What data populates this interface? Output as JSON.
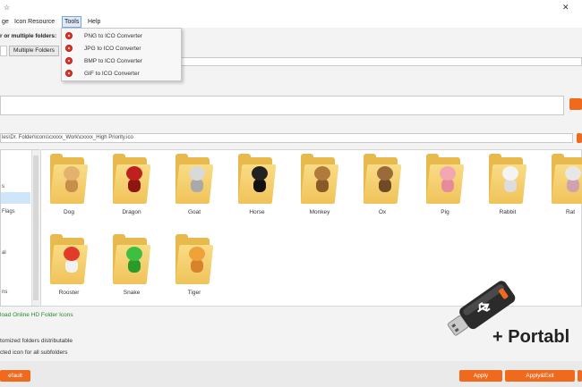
{
  "window": {
    "close_glyph": "✕"
  },
  "menubar": {
    "items": [
      {
        "label": "ge"
      },
      {
        "label": "Icon Resource"
      },
      {
        "label": "Tools"
      },
      {
        "label": "Help"
      }
    ]
  },
  "tools_menu": {
    "items": [
      {
        "label": "PNG to ICO Converter",
        "icon": "converter-icon"
      },
      {
        "label": "JPG to ICO Converter",
        "icon": "converter-icon"
      },
      {
        "label": "BMP to ICO Converter",
        "icon": "converter-icon"
      },
      {
        "label": "GIF to ICO Converter",
        "icon": "converter-icon"
      }
    ]
  },
  "selection": {
    "prompt": "r or multiple folders:",
    "multiple_folders_button": "Multiple Folders"
  },
  "icon_path": "les\\Dr. Folder\\icons\\cxxxx_Work\\cxxxx_High Priority.ico",
  "tree": {
    "items": [
      {
        "label": "s"
      },
      {
        "label": "Flags"
      },
      {
        "label": "al"
      },
      {
        "label": "ns"
      }
    ]
  },
  "icons": [
    {
      "name": "Dog",
      "head": "#e3b36e",
      "body": "#c98f4a"
    },
    {
      "name": "Dragon",
      "head": "#c0201d",
      "body": "#8f1512"
    },
    {
      "name": "Goat",
      "head": "#d9d9d9",
      "body": "#a9a9a9"
    },
    {
      "name": "Horse",
      "head": "#222222",
      "body": "#111111"
    },
    {
      "name": "Monkey",
      "head": "#b07a3c",
      "body": "#8a5a28"
    },
    {
      "name": "Ox",
      "head": "#9a6a3a",
      "body": "#6f4a24"
    },
    {
      "name": "Pig",
      "head": "#f2a7b3",
      "body": "#e58b9c"
    },
    {
      "name": "Rabbit",
      "head": "#f4f4f4",
      "body": "#dddddd"
    },
    {
      "name": "Rat",
      "head": "#e7e7e7",
      "body": "#d0a2b0"
    },
    {
      "name": "Rooster",
      "head": "#e23b2a",
      "body": "#f2f2f2"
    },
    {
      "name": "Snake",
      "head": "#3fbf3f",
      "body": "#2a9a2a"
    },
    {
      "name": "Tiger",
      "head": "#f0a23a",
      "body": "#d8822a"
    }
  ],
  "download_link": "load Online HD Folder Icons",
  "options": [
    {
      "label": "tomized folders distributable"
    },
    {
      "label": "cted icon for all subfolders"
    }
  ],
  "buttons": {
    "default": "efault",
    "apply": "Apply",
    "apply_exit": "Apply&Exit"
  },
  "promo": {
    "text": "+ Portabl"
  },
  "colors": {
    "accent": "#f06a1e",
    "link": "#2a8a2a",
    "menu_highlight": "#dbe9f8"
  }
}
